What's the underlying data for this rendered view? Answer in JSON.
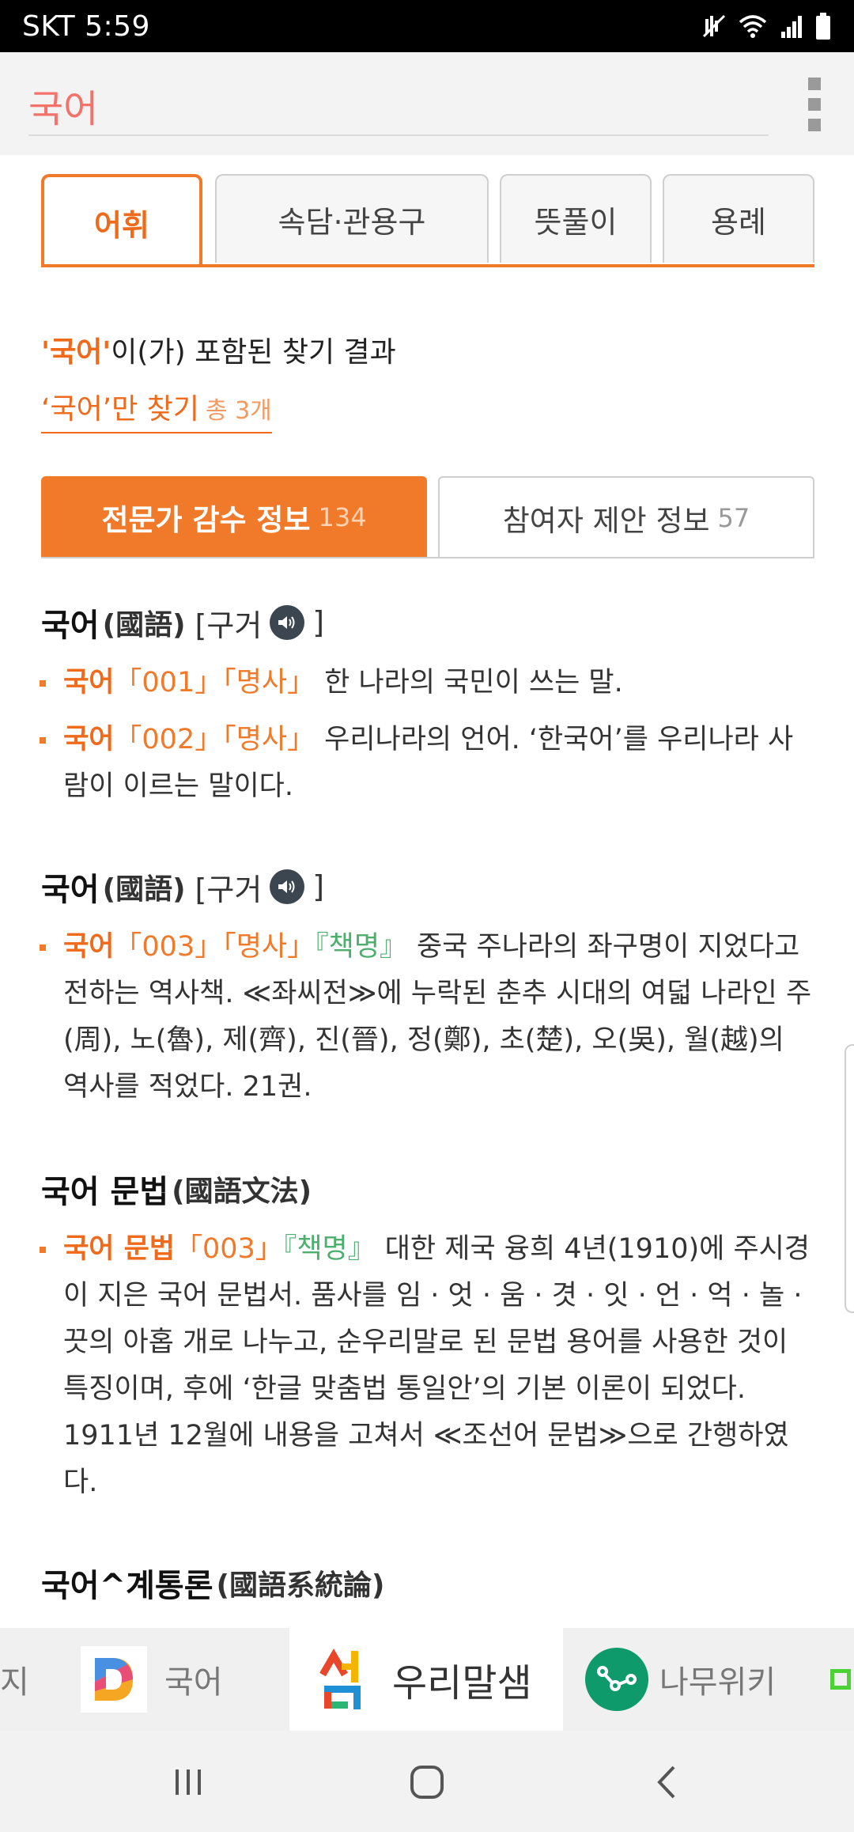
{
  "status_bar": {
    "carrier_time": "SKT 5:59"
  },
  "search": {
    "value": "국어"
  },
  "tabs": [
    {
      "label": "어휘",
      "active": true
    },
    {
      "label": "속담·관용구"
    },
    {
      "label": "뜻풀이"
    },
    {
      "label": "용례"
    }
  ],
  "result": {
    "keyword": "'국어'",
    "suffix": "이(가) 포함된 찾기 결과",
    "only_link": "‘국어’만 찾기",
    "only_count": "총 3개"
  },
  "info_tabs": {
    "expert_label": "전문가 감수 정보",
    "expert_count": "134",
    "user_label": "참여자 제안 정보",
    "user_count": "57"
  },
  "entries": [
    {
      "word": "국어",
      "hanja": "(國語)",
      "pron_open": "[구거",
      "pron_close": "]",
      "defs": [
        {
          "word": "국어",
          "tags": "「001」「명사」",
          "tag2": "",
          "text": "한 나라의 국민이 쓰는 말."
        },
        {
          "word": "국어",
          "tags": "「002」「명사」",
          "tag2": "",
          "text": "우리나라의 언어. ‘한국어’를 우리나라 사람이 이르는 말이다."
        }
      ]
    },
    {
      "word": "국어",
      "hanja": "(國語)",
      "pron_open": "[구거",
      "pron_close": "]",
      "defs": [
        {
          "word": "국어",
          "tags": "「003」「명사」",
          "tag2": "『책명』",
          "text": "중국 주나라의 좌구명이 지었다고 전하는 역사책. ≪좌씨전≫에 누락된 춘추 시대의 여덟 나라인 주(周), 노(魯), 제(齊), 진(晉), 정(鄭), 초(楚), 오(吳), 월(越)의 역사를 적었다. 21권."
        }
      ]
    },
    {
      "word": "국어 문법",
      "hanja": "(國語文法)",
      "defs": [
        {
          "word": "국어 문법",
          "tags": "「003」",
          "tag2": "『책명』",
          "text": "대한 제국 융희 4년(1910)에 주시경이 지은 국어 문법서. 품사를 임 · 엇 · 움 · 겻 · 잇 · 언 · 억 · 놀 · 끗의 아홉 개로 나누고, 순우리말로 된 문법 용어를 사용한 것이 특징이며, 후에 ‘한글 맞춤법 통일안’의 기본 이론이 되었다. 1911년 12월에 내용을 고쳐서 ≪조선어 문법≫으로 간행하였다."
        }
      ]
    },
    {
      "word": "국어^계통론",
      "hanja": "(國語系統論)"
    }
  ],
  "switcher": {
    "partial_left": "지",
    "daum_label": "국어",
    "urimal_label": "우리말샘",
    "namu_label": "나무위키"
  },
  "colors": {
    "accent": "#f07a2a",
    "search_text": "#f4726a",
    "tag_green": "#4caf6e"
  },
  "icons": [
    "wifi-icon",
    "signal-icon",
    "battery-icon",
    "mute-icon",
    "speaker-icon",
    "kebab-menu-icon",
    "recents-icon",
    "home-icon",
    "back-icon"
  ]
}
